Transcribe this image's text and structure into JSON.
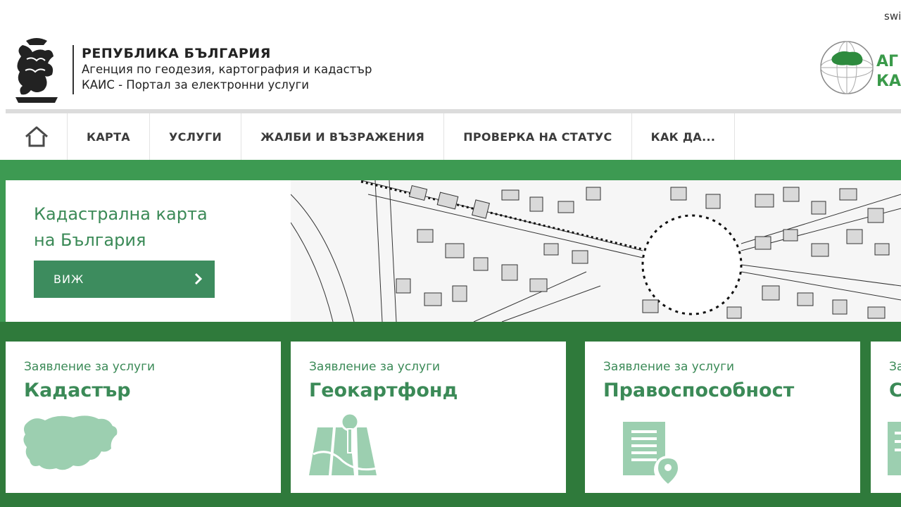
{
  "top_link": "switch",
  "header": {
    "title": "РЕПУБЛИКА БЪЛГАРИЯ",
    "agency": "Агенция по геодезия, картография и кадастър",
    "portal": "КАИС - Портал за електронни услуги",
    "logo_text_line1": "АГ",
    "logo_text_line2": "КА"
  },
  "nav": {
    "home_icon": "home-icon",
    "items": [
      "КАРТА",
      "УСЛУГИ",
      "ЖАЛБИ И ВЪЗРАЖЕНИЯ",
      "ПРОВЕРКА НА СТАТУС",
      "КАК ДА..."
    ]
  },
  "hero": {
    "title_line1": "Кадастрална карта",
    "title_line2": "на България",
    "button": "ВИЖ"
  },
  "cards": [
    {
      "subtitle": "Заявление за услуги",
      "title": "Кадастър",
      "icon": "bulgaria-map-icon"
    },
    {
      "subtitle": "Заявление за услуги",
      "title": "Геокартфонд",
      "icon": "map-pin-icon"
    },
    {
      "subtitle": "Заявление за услуги",
      "title": "Правоспособност",
      "icon": "document-pin-icon"
    },
    {
      "subtitle": "Заявление за услуги",
      "title": "С",
      "icon": "document-icon"
    }
  ],
  "colors": {
    "green": "#3d9a52",
    "green_dark": "#2f7a3b",
    "text_green": "#3b8a57",
    "icon_green": "#9ccfb0"
  }
}
